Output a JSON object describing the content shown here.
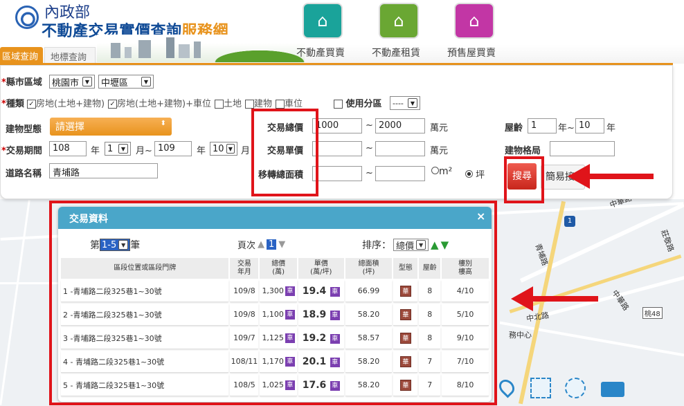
{
  "header": {
    "ministry": "內政部",
    "service_title_main": "不動產交易實價查詢",
    "service_title_accent": "服務網",
    "nav": [
      {
        "label": "不動產買賣",
        "icon": "house-dollar-icon",
        "color": "#1aa39a"
      },
      {
        "label": "不動產租賃",
        "icon": "house-rent-icon",
        "color": "#6aa733"
      },
      {
        "label": "預售屋買賣",
        "icon": "crane-house-icon",
        "color": "#c236a5"
      }
    ],
    "tabs": [
      "區域查詢",
      "地標查詢"
    ]
  },
  "form": {
    "city_label": "縣市區域",
    "city_value": "桃園市",
    "district_value": "中壢區",
    "type_label": "種類",
    "types": [
      {
        "label": "房地(土地+建物)",
        "checked": true
      },
      {
        "label": "房地(土地+建物)+車位",
        "checked": true
      },
      {
        "label": "土地",
        "checked": false
      },
      {
        "label": "建物",
        "checked": false
      },
      {
        "label": "車位",
        "checked": false
      }
    ],
    "zoning_label": "使用分區",
    "zoning_value": "----",
    "building_type_label": "建物型態",
    "building_type_value": "請選擇",
    "period_label": "交易期間",
    "period_from_year": "108",
    "period_from_month": "1",
    "period_to_year": "109",
    "period_to_month": "10",
    "year_unit": "年",
    "month_unit_from": "月~",
    "month_unit_to": "月",
    "road_label": "道路名稱",
    "road_value": "青埔路",
    "total_price_label": "交易總價",
    "total_price_from": "1000",
    "total_price_to": "2000",
    "price_unit": "萬元",
    "tilde": "~",
    "unit_price_label": "交易單價",
    "area_label": "移轉總面積",
    "area_unit_m2": "m²",
    "area_unit_ping": "坪",
    "age_label": "屋齡",
    "age_from": "1",
    "age_to": "10",
    "age_unit_from": "年~",
    "age_unit_to": "年",
    "layout_label": "建物格局",
    "search_button": "搜尋",
    "simple_button": "簡易接"
  },
  "map": {
    "road_labels": [
      "中華路",
      "中北路",
      "青埔路",
      "莊敬路",
      "中華路",
      "桃48",
      "務中心"
    ],
    "route_badge": "1"
  },
  "results": {
    "title": "交易資料",
    "close": "×",
    "range_prefix": "第",
    "range_value": "1-5",
    "range_suffix": "筆",
    "page_label": "頁次",
    "page_value": "1",
    "sort_label": "排序：",
    "sort_value": "總價",
    "columns": [
      "區段位置或區段門牌",
      "交易\n年月",
      "總價\n(萬)",
      "單價\n(萬/坪)",
      "總面積\n(坪)",
      "型態",
      "屋齡",
      "樓別\n樓高"
    ],
    "type_glyph": "華",
    "car_glyph": "車",
    "rows": [
      {
        "address": "1 -青埔路二段325巷1~30號",
        "date": "109/8",
        "total": "1,300",
        "unit": "19.4",
        "area": "66.99",
        "age": "8",
        "floor": "4/10"
      },
      {
        "address": "2 -青埔路二段325巷1~30號",
        "date": "109/8",
        "total": "1,100",
        "unit": "18.9",
        "area": "58.20",
        "age": "8",
        "floor": "5/10"
      },
      {
        "address": "3 -青埔路二段325巷1~30號",
        "date": "109/7",
        "total": "1,125",
        "unit": "19.2",
        "area": "58.57",
        "age": "8",
        "floor": "9/10"
      },
      {
        "address": "4 - 青埔路二段325巷1~30號",
        "date": "108/11",
        "total": "1,170",
        "unit": "20.1",
        "area": "58.20",
        "age": "7",
        "floor": "7/10"
      },
      {
        "address": "5 - 青埔路二段325巷1~30號",
        "date": "108/5",
        "total": "1,025",
        "unit": "17.6",
        "area": "58.20",
        "age": "7",
        "floor": "8/10"
      }
    ]
  }
}
